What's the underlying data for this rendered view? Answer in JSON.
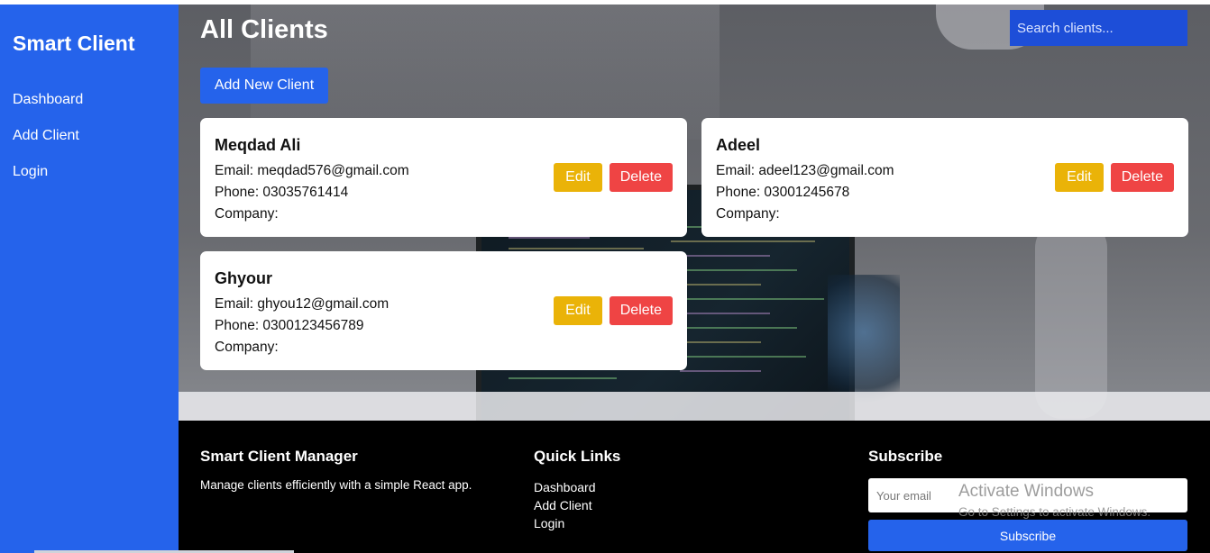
{
  "sidebar": {
    "brand": "Smart Client",
    "items": [
      {
        "label": "Dashboard"
      },
      {
        "label": "Add Client"
      },
      {
        "label": "Login"
      }
    ]
  },
  "main": {
    "title": "All Clients",
    "search_placeholder": "Search clients...",
    "add_label": "Add New Client",
    "edit_label": "Edit",
    "delete_label": "Delete",
    "clients": [
      {
        "name": "Meqdad Ali",
        "email": "Email: meqdad576@gmail.com",
        "phone": "Phone: 03035761414",
        "company": "Company:"
      },
      {
        "name": "Adeel",
        "email": "Email: adeel123@gmail.com",
        "phone": "Phone: 03001245678",
        "company": "Company:"
      },
      {
        "name": "Ghyour",
        "email": "Email: ghyou12@gmail.com",
        "phone": "Phone: 0300123456789",
        "company": "Company:"
      }
    ]
  },
  "footer": {
    "about_title": "Smart Client Manager",
    "about_text": "Manage clients efficiently with a simple React app.",
    "links_title": "Quick Links",
    "links": [
      {
        "label": "Dashboard"
      },
      {
        "label": "Add Client"
      },
      {
        "label": "Login"
      }
    ],
    "subscribe_title": "Subscribe",
    "email_placeholder": "Your email",
    "subscribe_label": "Subscribe"
  },
  "watermark": {
    "line1": "Activate Windows",
    "line2": "Go to Settings to activate Windows."
  },
  "colors": {
    "primary": "#2563eb",
    "edit": "#eab308",
    "delete": "#ef4444",
    "footer_bg": "#000000"
  }
}
